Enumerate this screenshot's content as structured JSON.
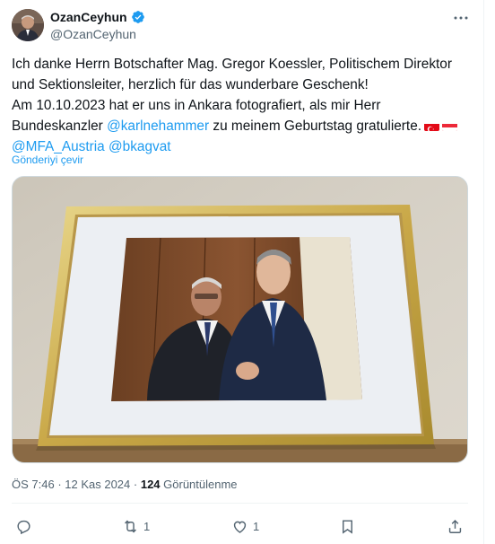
{
  "author": {
    "display_name": "OzanCeyhun",
    "handle": "@OzanCeyhun",
    "avatar_icon": "profile-photo",
    "verified_icon": "verified-badge-icon",
    "verified_color": "#1d9bf0"
  },
  "tweet": {
    "line1": "Ich danke Herrn Botschafter Mag. Gregor Koessler, Politischem Direktor",
    "line2": "und Sektionsleiter, herzlich für das wunderbare Geschenk!",
    "line3": "Am 10.10.2023 hat er uns in Ankara fotografiert, als mir Herr",
    "line4_prefix": "Bundeskanzler ",
    "line4_mention": "@karlnehammer",
    "line4_suffix": " zu meinem Geburtstag gratulierte.",
    "flags": [
      "turkey-flag",
      "austria-flag"
    ],
    "line5_mention1": "@MFA_Austria",
    "line5_space": " ",
    "line5_mention2": "@bkagvat",
    "mention_color": "#1d9bf0"
  },
  "translate_label": "Gönderiyi çevir",
  "media": {
    "description_icon": "framed-photo-image"
  },
  "meta": {
    "time": "ÖS 7:46",
    "sep1": " · ",
    "date": "12 Kas 2024",
    "sep2": " · ",
    "views_count": "124",
    "views_label": " Görüntülenme"
  },
  "actions": {
    "reply_count": "",
    "retweet_count": "1",
    "like_count": "1",
    "bookmark_count": "",
    "share_count": ""
  }
}
